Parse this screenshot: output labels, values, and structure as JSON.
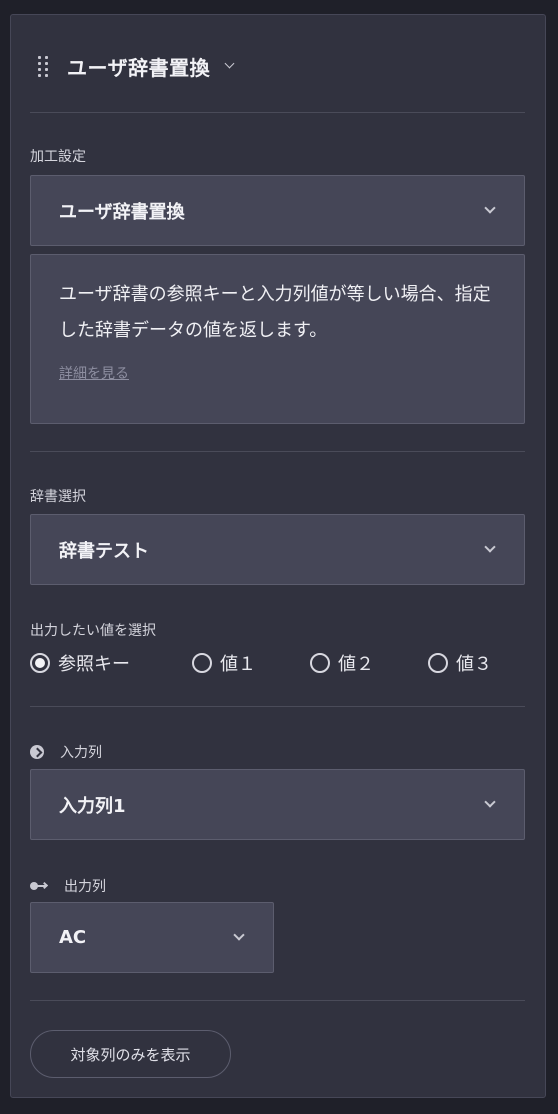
{
  "header": {
    "title": "ユーザ辞書置換"
  },
  "processing": {
    "label": "加工設定",
    "selected": "ユーザ辞書置換",
    "description": "ユーザ辞書の参照キーと入力列値が等しい場合、指定した辞書データの値を返します。",
    "details_link": "詳細を見る"
  },
  "dictionary": {
    "label": "辞書選択",
    "selected": "辞書テスト"
  },
  "output_value": {
    "label": "出力したい値を選択",
    "options": [
      {
        "label": "参照キー",
        "checked": true
      },
      {
        "label": "値１",
        "checked": false
      },
      {
        "label": "値２",
        "checked": false
      },
      {
        "label": "値３",
        "checked": false
      }
    ]
  },
  "input_column": {
    "label": "入力列",
    "selected": "入力列1"
  },
  "output_column": {
    "label": "出力列",
    "selected": "AC"
  },
  "filter_button": {
    "label": "対象列のみを表示"
  }
}
